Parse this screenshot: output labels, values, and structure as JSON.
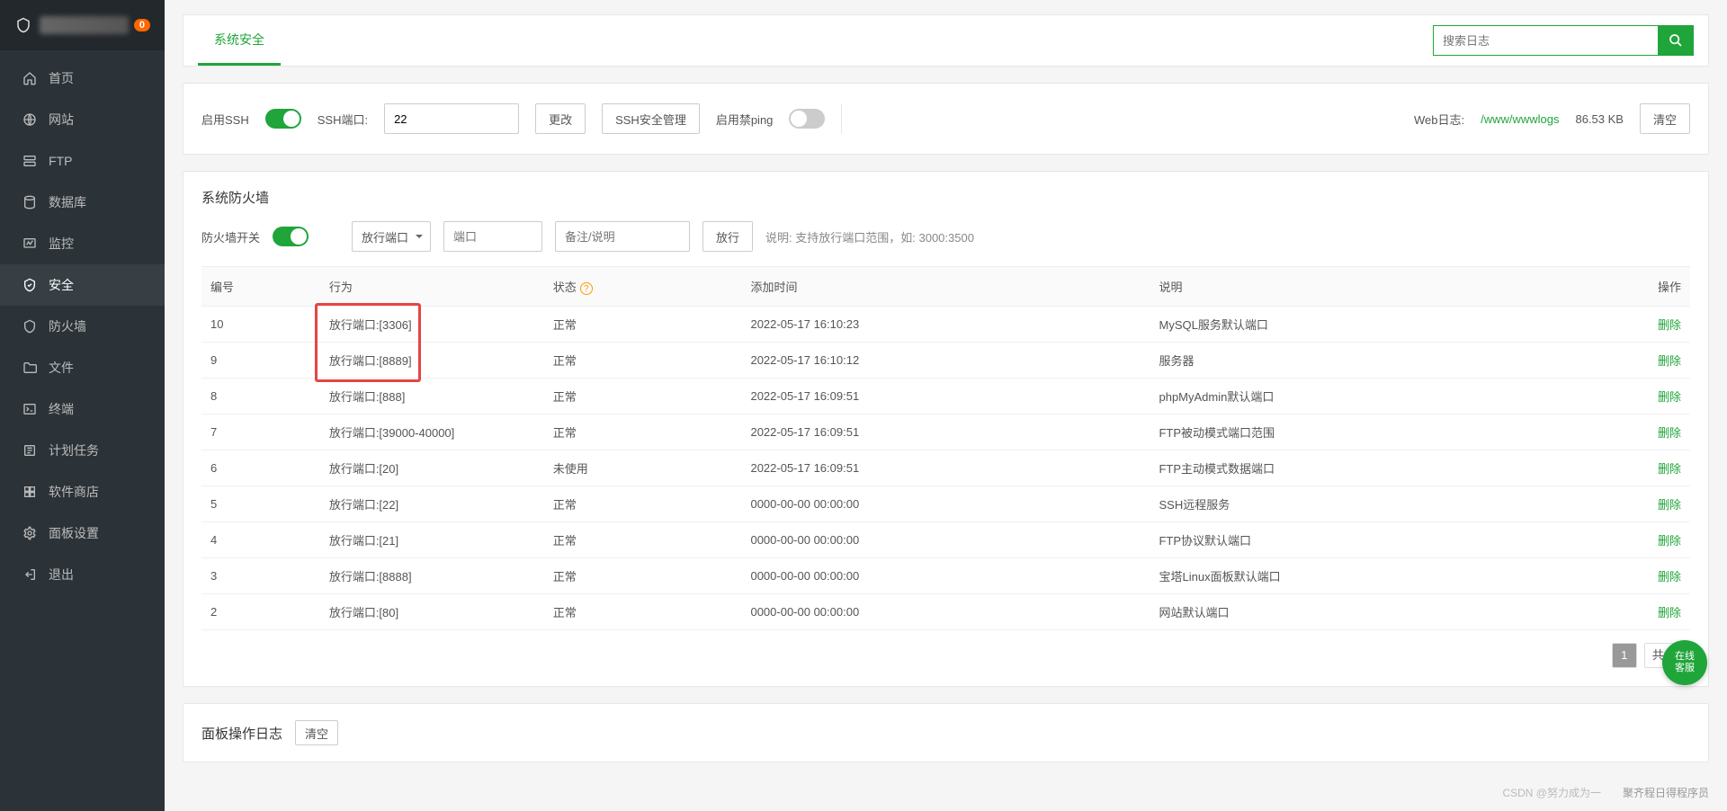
{
  "sidebar": {
    "badge": "0",
    "items": [
      {
        "id": "home",
        "label": "首页"
      },
      {
        "id": "site",
        "label": "网站"
      },
      {
        "id": "ftp",
        "label": "FTP"
      },
      {
        "id": "db",
        "label": "数据库"
      },
      {
        "id": "monitor",
        "label": "监控"
      },
      {
        "id": "security",
        "label": "安全",
        "active": true
      },
      {
        "id": "firewall",
        "label": "防火墙"
      },
      {
        "id": "file",
        "label": "文件"
      },
      {
        "id": "terminal",
        "label": "终端"
      },
      {
        "id": "cron",
        "label": "计划任务"
      },
      {
        "id": "store",
        "label": "软件商店"
      },
      {
        "id": "settings",
        "label": "面板设置"
      },
      {
        "id": "logout",
        "label": "退出"
      }
    ]
  },
  "tabs": {
    "system_security": "系统安全"
  },
  "search": {
    "placeholder": "搜索日志"
  },
  "ssh_row": {
    "enable_label": "启用SSH",
    "enable_on": true,
    "port_label": "SSH端口:",
    "port_value": "22",
    "change_btn": "更改",
    "manage_btn": "SSH安全管理",
    "ping_label": "启用禁ping",
    "ping_on": false,
    "weblog_label": "Web日志:",
    "weblog_path": "/www/wwwlogs",
    "weblog_size": "86.53 KB",
    "clear_btn": "清空"
  },
  "firewall": {
    "card_title": "系统防火墙",
    "switch_label": "防火墙开关",
    "switch_on": true,
    "port_type": "放行端口",
    "port_placeholder": "端口",
    "note_placeholder": "备注/说明",
    "release_btn": "放行",
    "hint": "说明: 支持放行端口范围，如: 3000:3500",
    "columns": {
      "id": "编号",
      "action": "行为",
      "status": "状态",
      "time": "添加时间",
      "desc": "说明",
      "op": "操作"
    },
    "delete_label": "删除",
    "rows": [
      {
        "id": "10",
        "action": "放行端口:[3306]",
        "status": "正常",
        "time": "2022-05-17 16:10:23",
        "desc": "MySQL服务默认端口"
      },
      {
        "id": "9",
        "action": "放行端口:[8889]",
        "status": "正常",
        "time": "2022-05-17 16:10:12",
        "desc": "服务器"
      },
      {
        "id": "8",
        "action": "放行端口:[888]",
        "status": "正常",
        "time": "2022-05-17 16:09:51",
        "desc": "phpMyAdmin默认端口"
      },
      {
        "id": "7",
        "action": "放行端口:[39000-40000]",
        "status": "正常",
        "time": "2022-05-17 16:09:51",
        "desc": "FTP被动模式端口范围"
      },
      {
        "id": "6",
        "action": "放行端口:[20]",
        "status": "未使用",
        "time": "2022-05-17 16:09:51",
        "desc": "FTP主动模式数据端口"
      },
      {
        "id": "5",
        "action": "放行端口:[22]",
        "status": "正常",
        "time": "0000-00-00 00:00:00",
        "desc": "SSH远程服务"
      },
      {
        "id": "4",
        "action": "放行端口:[21]",
        "status": "正常",
        "time": "0000-00-00 00:00:00",
        "desc": "FTP协议默认端口"
      },
      {
        "id": "3",
        "action": "放行端口:[8888]",
        "status": "正常",
        "time": "0000-00-00 00:00:00",
        "desc": "宝塔Linux面板默认端口"
      },
      {
        "id": "2",
        "action": "放行端口:[80]",
        "status": "正常",
        "time": "0000-00-00 00:00:00",
        "desc": "网站默认端口"
      }
    ],
    "pager": {
      "current": "1",
      "total": "共9条"
    }
  },
  "log_card": {
    "title": "面板操作日志",
    "clear_btn": "清空"
  },
  "floating": {
    "kefu": "在线\n客服"
  },
  "watermark1": "CSDN @努力成为一",
  "watermark2": "聚齐程日得程序员"
}
